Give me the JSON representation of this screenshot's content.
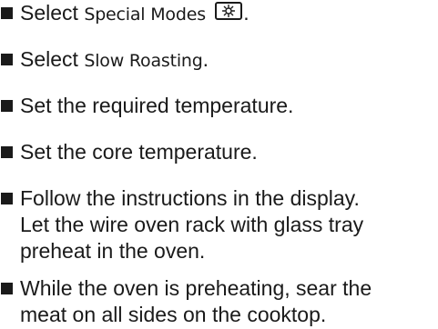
{
  "steps": [
    {
      "prefix": "Select",
      "ui_label": "Special Modes",
      "icon": "special-modes-icon",
      "suffix": "."
    },
    {
      "prefix": "Select",
      "ui_label": "Slow Roasting",
      "suffix": "."
    },
    {
      "text": "Set the required temperature."
    },
    {
      "text": "Set the core temperature."
    },
    {
      "line1": "Follow the instructions in the display.",
      "line2": "Let the wire oven rack with glass tray",
      "line3": "preheat in the oven."
    },
    {
      "line1": "While the oven is preheating, sear the",
      "line2": "meat on all sides on the cooktop."
    }
  ]
}
